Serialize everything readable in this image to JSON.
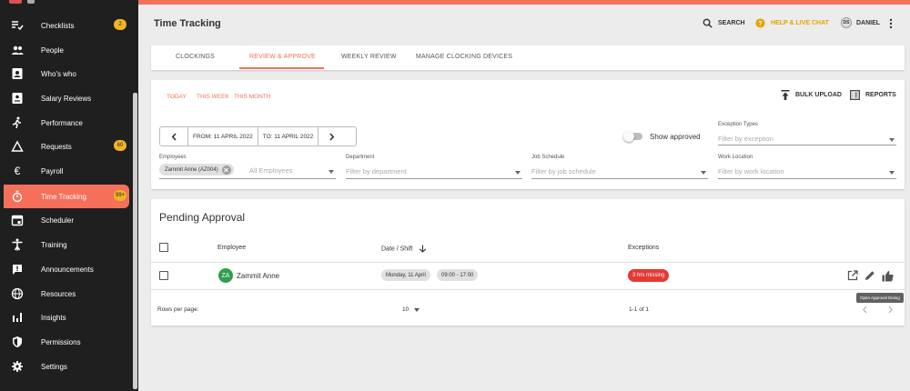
{
  "sidebar": {
    "items": [
      {
        "label": "Checklists",
        "icon": "checklist-icon",
        "badge": "2"
      },
      {
        "label": "People",
        "icon": "people-icon",
        "badge": ""
      },
      {
        "label": "Who's who",
        "icon": "contact-card-icon",
        "badge": ""
      },
      {
        "label": "Salary Reviews",
        "icon": "salary-review-icon",
        "badge": ""
      },
      {
        "label": "Performance",
        "icon": "running-person-icon",
        "badge": ""
      },
      {
        "label": "Requests",
        "icon": "triangle-icon",
        "badge": "60"
      },
      {
        "label": "Payroll",
        "icon": "euro-icon",
        "badge": ""
      },
      {
        "label": "Time Tracking",
        "icon": "stopwatch-icon",
        "badge": "99+"
      },
      {
        "label": "Scheduler",
        "icon": "calendar-icon",
        "badge": ""
      },
      {
        "label": "Training",
        "icon": "person-training-icon",
        "badge": ""
      },
      {
        "label": "Announcements",
        "icon": "announcement-icon",
        "badge": ""
      },
      {
        "label": "Resources",
        "icon": "globe-icon",
        "badge": ""
      },
      {
        "label": "Insights",
        "icon": "bar-chart-icon",
        "badge": ""
      },
      {
        "label": "Permissions",
        "icon": "shield-icon",
        "badge": ""
      },
      {
        "label": "Settings",
        "icon": "gear-icon",
        "badge": ""
      }
    ],
    "active_index": 7
  },
  "header": {
    "title": "Time Tracking",
    "search_label": "SEARCH",
    "help_label": "HELP & LIVE CHAT",
    "user_initials": "DS",
    "user_name": "DANIEL"
  },
  "tabs": [
    {
      "label": "CLOCKINGS",
      "active": false
    },
    {
      "label": "REVIEW & APPROVE",
      "active": true
    },
    {
      "label": "WEEKLY REVIEW",
      "active": false
    },
    {
      "label": "MANAGE CLOCKING DEVICES",
      "active": false
    }
  ],
  "filters": {
    "quick": {
      "today": "TODAY",
      "this_week": "THIS WEEK",
      "this_month": "THIS MONTH"
    },
    "bulk_upload": "BULK UPLOAD",
    "reports": "REPORTS",
    "date_from": "FROM: 11 APRIL 2022",
    "date_to": "TO: 11 APRIL 2022",
    "show_approved": "Show approved",
    "exception_types": {
      "label": "Exception Types",
      "placeholder": "Filter by exception"
    },
    "employees": {
      "label": "Employees",
      "chip": "Zammit Anne (AZ004)",
      "placeholder": "All Employees"
    },
    "department": {
      "label": "Department",
      "placeholder": "Filter by department"
    },
    "job_schedule": {
      "label": "Job Schedule",
      "placeholder": "Filter by job schedule"
    },
    "work_location": {
      "label": "Work Location",
      "placeholder": "Filter by work location"
    }
  },
  "pending": {
    "title": "Pending Approval",
    "columns": {
      "employee": "Employee",
      "date_shift": "Date / Shift",
      "exceptions": "Exceptions"
    },
    "rows": [
      {
        "initials": "ZA",
        "name": "Zammit Anne",
        "date": "Monday, 11 April",
        "shift": "09:00 - 17:00",
        "exception": "3 hrs missing"
      }
    ],
    "rows_per_page_label": "Rows per page:",
    "rows_per_page": "10",
    "range": "1-1 of 1",
    "tooltip": "Open Approval Dialog"
  },
  "colors": {
    "accent": "#f4705a",
    "sidebar_bg": "#1f1f1f",
    "badge": "#f0b429",
    "help": "#e0a500",
    "danger": "#e53935",
    "avatar": "#2e9e4f"
  }
}
